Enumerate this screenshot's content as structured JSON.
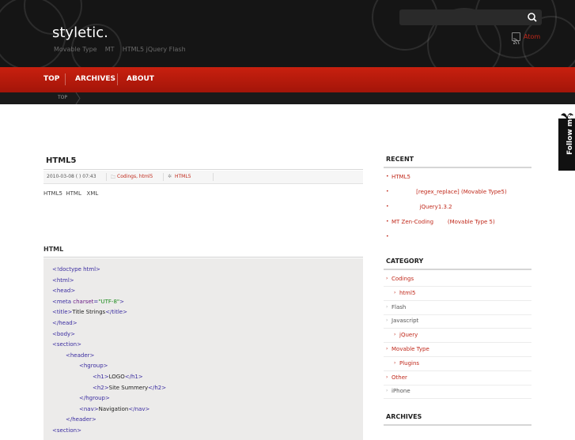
{
  "header": {
    "logo": "styletic.",
    "tagline": "Movable Type    MT    HTML5 jQuery Flash",
    "rss_label": "Atom",
    "search_icon": "search-icon"
  },
  "nav": {
    "items": [
      "TOP",
      "ARCHIVES",
      "ABOUT"
    ]
  },
  "breadcrumb": {
    "top": "TOP"
  },
  "follow": {
    "label": "Follow me"
  },
  "post": {
    "title": "HTML5",
    "date": "2010-03-08 ( ) 07:43",
    "categories": "Codings, html5",
    "tags": "HTML5",
    "body": "HTML5  HTML   XML",
    "code_heading": "HTML",
    "code_lines": [
      {
        "indent": 0,
        "parts": [
          [
            "tag",
            "<!doctype html>"
          ]
        ]
      },
      {
        "indent": 0,
        "parts": [
          [
            "tag",
            "<html>"
          ]
        ]
      },
      {
        "indent": 0,
        "parts": [
          [
            "tag",
            "<head>"
          ]
        ]
      },
      {
        "indent": 0,
        "parts": [
          [
            "tag",
            "<meta "
          ],
          [
            "attr",
            "charset"
          ],
          [
            "tag",
            "="
          ],
          [
            "str",
            "\"UTF-8\""
          ],
          [
            "tag",
            ">"
          ]
        ]
      },
      {
        "indent": 0,
        "parts": [
          [
            "tag",
            "<title>"
          ],
          [
            "text",
            "Title Strings"
          ],
          [
            "tag",
            "</title>"
          ]
        ]
      },
      {
        "indent": 0,
        "parts": [
          [
            "tag",
            "</head>"
          ]
        ]
      },
      {
        "indent": 0,
        "parts": [
          [
            "tag",
            "<body>"
          ]
        ]
      },
      {
        "indent": 0,
        "parts": [
          [
            "tag",
            "<section>"
          ]
        ]
      },
      {
        "indent": 1,
        "parts": [
          [
            "tag",
            "<header>"
          ]
        ]
      },
      {
        "indent": 2,
        "parts": [
          [
            "tag",
            "<hgroup>"
          ]
        ]
      },
      {
        "indent": 3,
        "parts": [
          [
            "tag",
            "<h1>"
          ],
          [
            "text",
            "LOGO"
          ],
          [
            "tag",
            "</h1>"
          ]
        ]
      },
      {
        "indent": 3,
        "parts": [
          [
            "tag",
            "<h2>"
          ],
          [
            "text",
            "Site Summery"
          ],
          [
            "tag",
            "</h2>"
          ]
        ]
      },
      {
        "indent": 2,
        "parts": [
          [
            "tag",
            "</hgroup>"
          ]
        ]
      },
      {
        "indent": 2,
        "parts": [
          [
            "tag",
            "<nav>"
          ],
          [
            "text",
            "Navigation"
          ],
          [
            "tag",
            "</nav>"
          ]
        ]
      },
      {
        "indent": 1,
        "parts": [
          [
            "tag",
            "</header>"
          ]
        ]
      },
      {
        "indent": 0,
        "parts": [
          [
            "tag",
            "<section>"
          ]
        ]
      }
    ]
  },
  "sidebar": {
    "recent_heading": "RECENT",
    "recent": [
      "HTML5",
      "              [regex_replace] (Movable Type5)",
      "                jQuery1.3.2",
      "MT Zen-Coding        (Movable Type 5)",
      ""
    ],
    "category_heading": "CATEGORY",
    "categories": [
      {
        "label": "Codings",
        "sub": false,
        "link": true
      },
      {
        "label": "html5",
        "sub": true,
        "link": true
      },
      {
        "label": "Flash",
        "sub": false,
        "link": false
      },
      {
        "label": "Javascript",
        "sub": false,
        "link": false
      },
      {
        "label": "jQuery",
        "sub": true,
        "link": true
      },
      {
        "label": "Movable Type",
        "sub": false,
        "link": true
      },
      {
        "label": "Plugins",
        "sub": true,
        "link": true
      },
      {
        "label": "Other",
        "sub": false,
        "link": true
      },
      {
        "label": "iPhone",
        "sub": false,
        "link": false
      }
    ],
    "archives_heading": "ARCHIVES"
  },
  "colors": {
    "accent": "#c0281a",
    "header_bg": "#151515",
    "nav_bg": "#b81a0c"
  }
}
